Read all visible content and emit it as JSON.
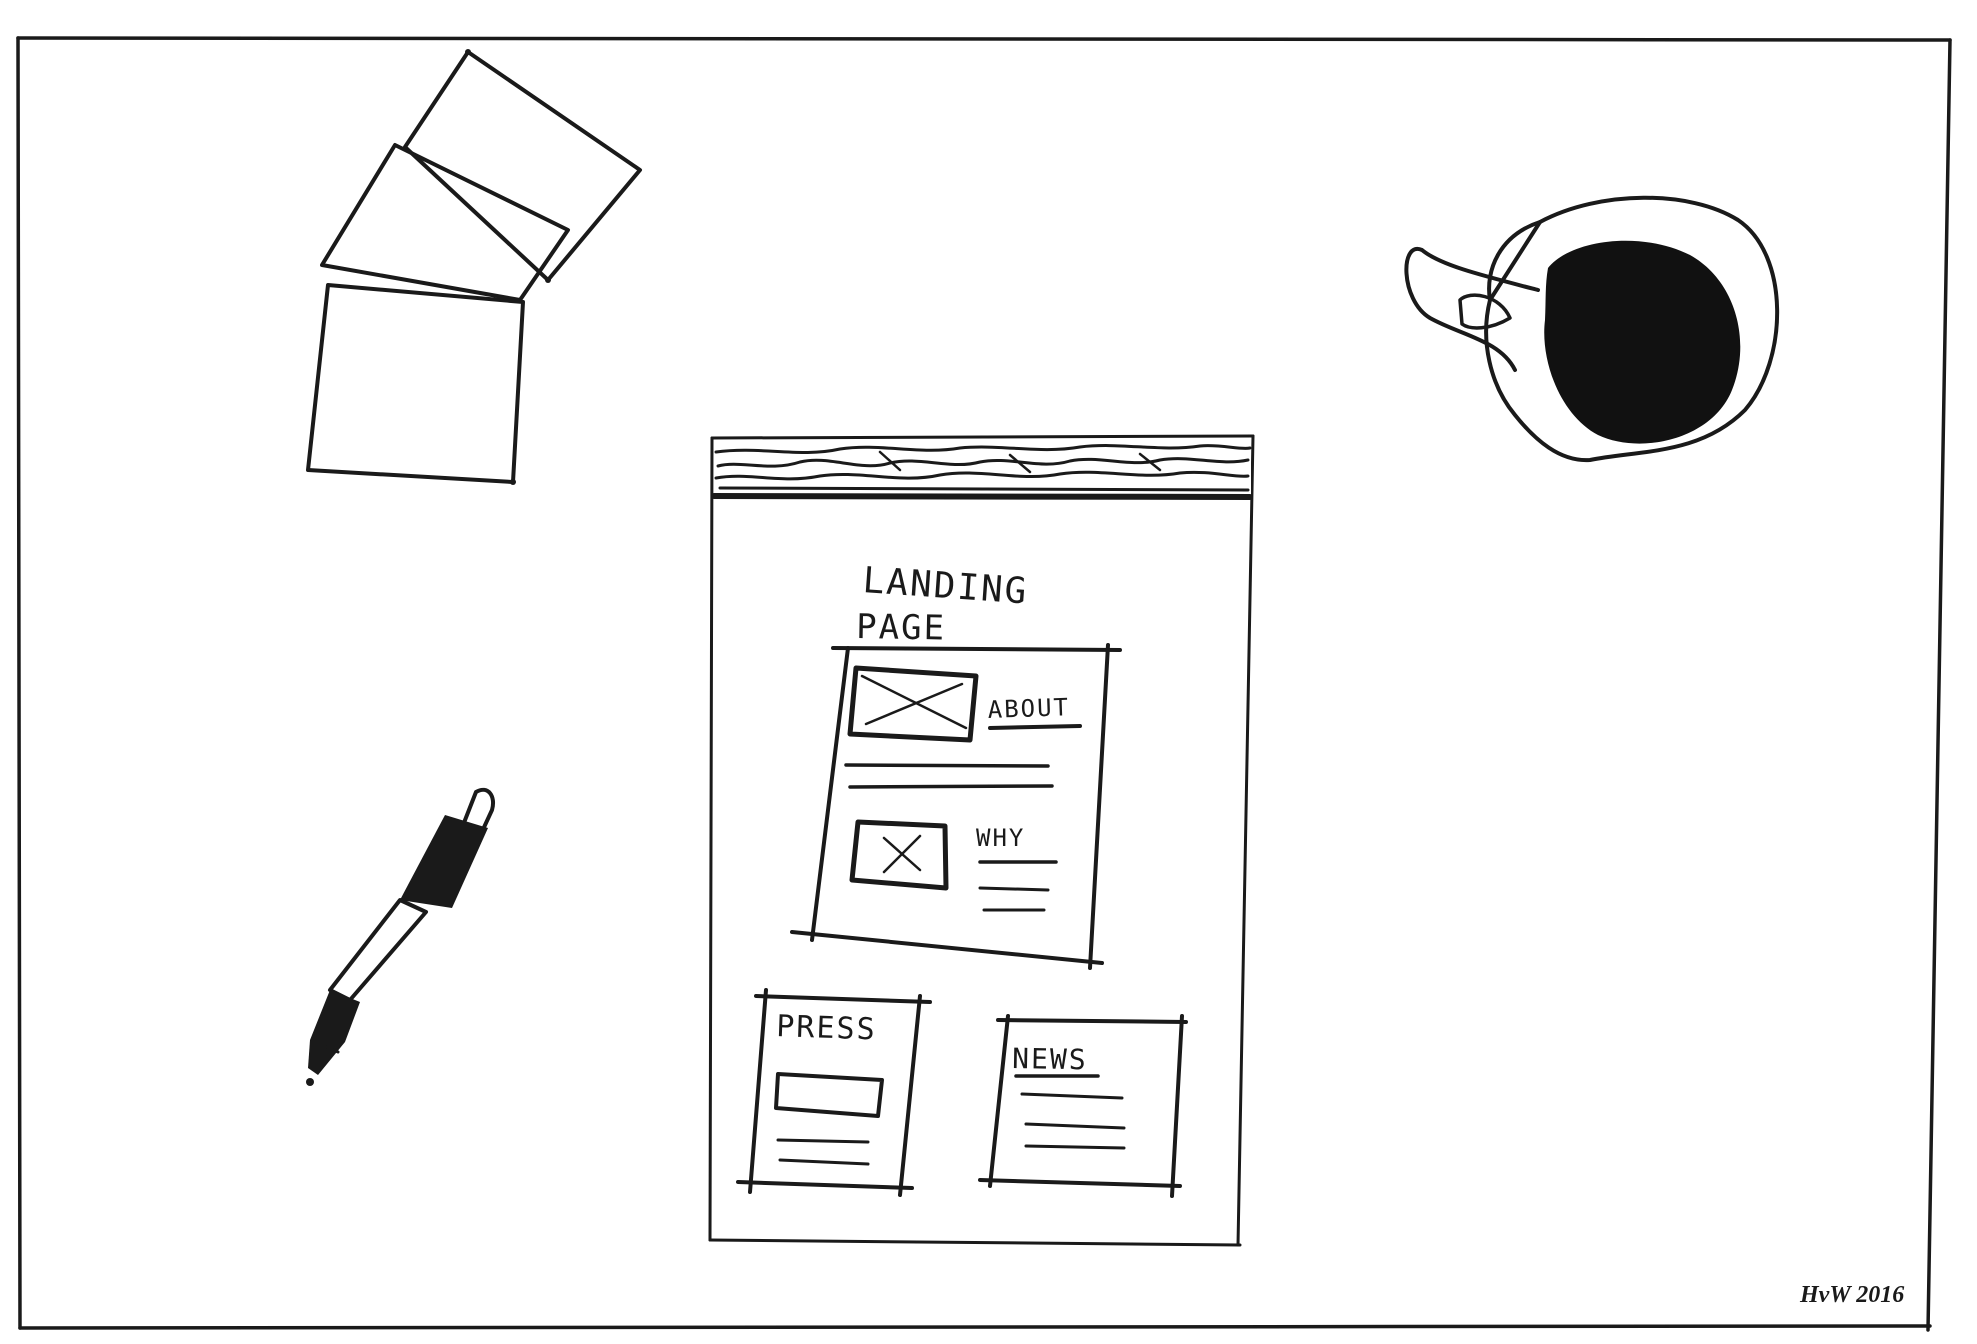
{
  "sketch": {
    "title_line_1": "LANDING",
    "title_line_2": "PAGE",
    "sections": {
      "about": "ABOUT",
      "why": "WHY",
      "press": "PRESS",
      "news": "NEWS"
    },
    "signature": "HvW 2016"
  },
  "colors": {
    "paper": "#ffffff",
    "ink": "#1a1a1a"
  }
}
